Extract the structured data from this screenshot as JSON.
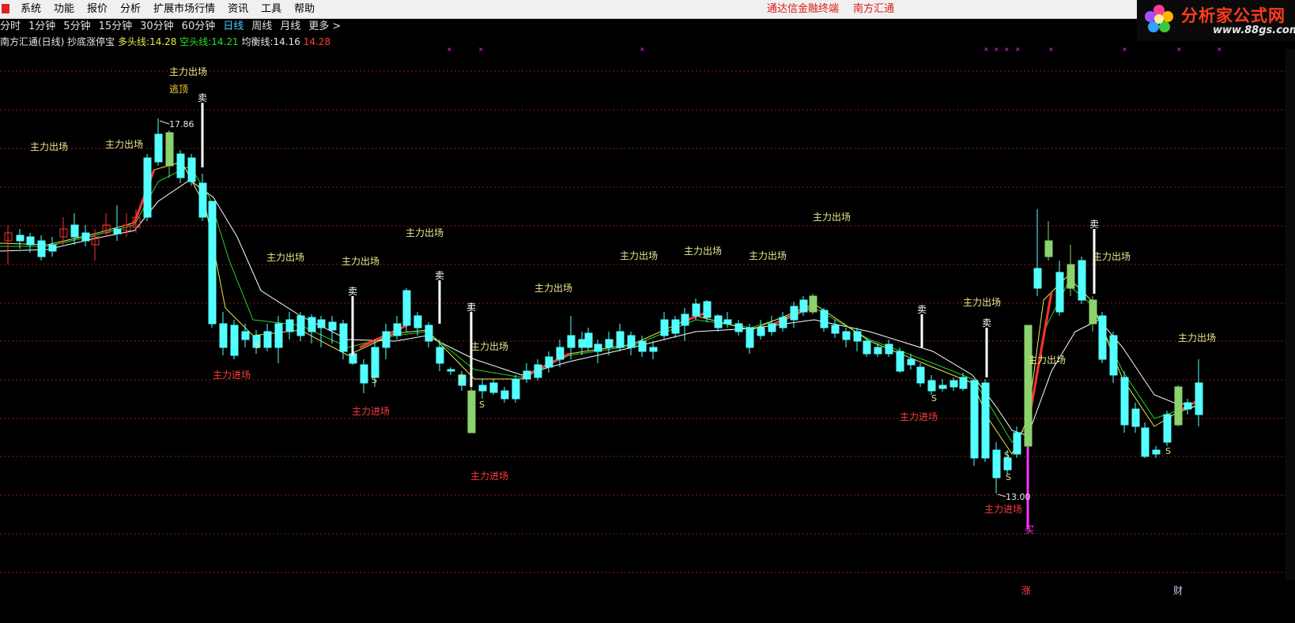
{
  "menubar": {
    "items": [
      "系统",
      "功能",
      "报价",
      "分析",
      "扩展市场行情",
      "资讯",
      "工具",
      "帮助"
    ],
    "links": [
      "通达信金融终端",
      "南方汇通"
    ]
  },
  "logo": {
    "brand": "分析家公式网",
    "site": "www.88gs.com"
  },
  "periodbar": {
    "tabs": [
      "分时",
      "1分钟",
      "5分钟",
      "15分钟",
      "30分钟",
      "60分钟",
      "日线",
      "周线",
      "月线",
      "更多 >"
    ],
    "active": "日线"
  },
  "indicator": {
    "title": "南方汇通(日线) 抄底涨停宝",
    "bull_label": "多头线:",
    "bull_value": "14.28",
    "bear_label": "空头线:",
    "bear_value": "14.21",
    "balance_label": "均衡线:",
    "balance_value": "14.16",
    "extra_value": "14.28"
  },
  "colors": {
    "up": "#ff3232",
    "down": "#54ffff",
    "flat": "#8cd26e",
    "bull_line": "#e8e850",
    "bear_line": "#28d228",
    "balance_line": "#ffffff",
    "grid": "#8c1e1e",
    "exit_text": "#e8e890",
    "entry_text": "#ff3c3c",
    "sell_signal": "#ffffff",
    "buy_signal": "#ff32ff",
    "escape_text": "#ffd23c",
    "marker": "#ff32ff"
  },
  "chart": {
    "high_label": "17.86",
    "low_label": "13.00",
    "exit_labels": [
      "主力出场",
      "主力出场",
      "主力出场",
      "主力出场",
      "主力出场",
      "主力出场",
      "主力出场",
      "主力出场",
      "主力出场",
      "主力出场",
      "主力出场",
      "主力出场",
      "主力出场",
      "主力出场",
      "主力出场",
      "主力出场"
    ],
    "entry_labels": [
      "主力进场",
      "主力进场",
      "主力进场",
      "主力进场",
      "主力进场"
    ],
    "escape_label": "逃顶",
    "sell_label": "卖",
    "buy_label": "买",
    "s_label": "S"
  },
  "bottom": {
    "marks": [
      "涨",
      "财"
    ]
  }
}
